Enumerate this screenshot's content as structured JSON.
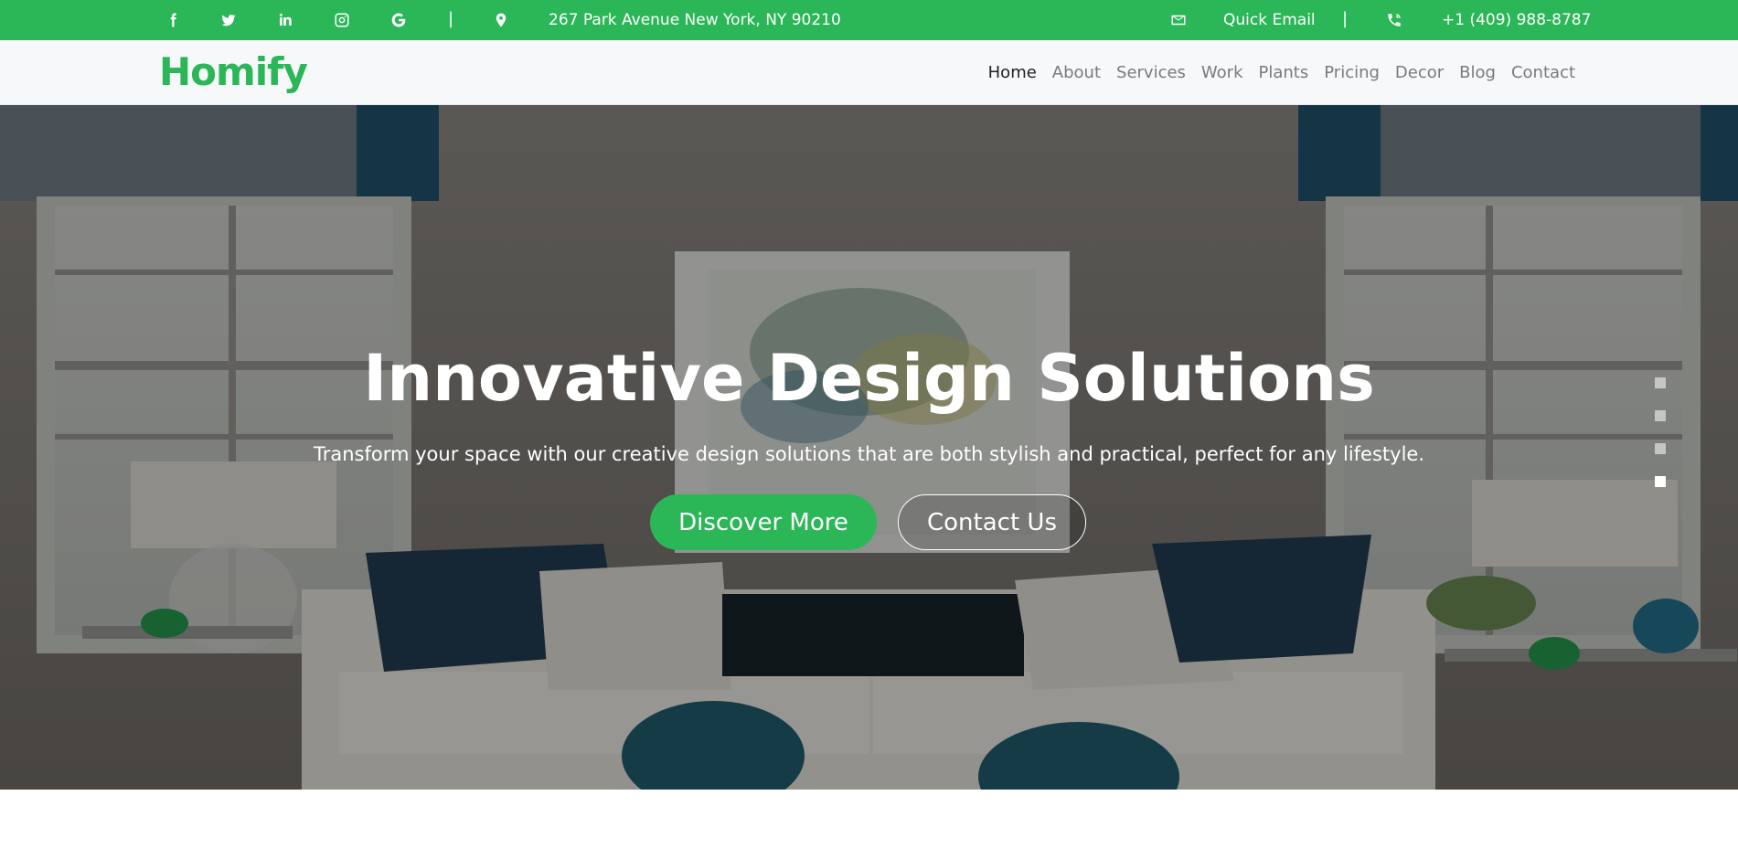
{
  "topbar": {
    "social": [
      {
        "icon": "facebook-icon"
      },
      {
        "icon": "twitter-icon"
      },
      {
        "icon": "linkedin-icon"
      },
      {
        "icon": "instagram-icon"
      },
      {
        "icon": "google-icon"
      }
    ],
    "separator": "|",
    "address": "267 Park Avenue New York, NY 90210",
    "email_label": "Quick Email",
    "phone": "+1 (409) 988-8787",
    "bg_color": "#2bb757"
  },
  "navbar": {
    "logo": "Homify",
    "links": [
      "Home",
      "About",
      "Services",
      "Work",
      "Plants",
      "Pricing",
      "Decor",
      "Blog",
      "Contact"
    ],
    "active": "Home"
  },
  "hero": {
    "title": "Innovative Design Solutions",
    "subtitle": "Transform your space with our creative design solutions that are both stylish and practical, perfect for any lifestyle.",
    "primary_button": "Discover More",
    "secondary_button": "Contact Us",
    "slides": 4,
    "active_slide": 4,
    "accent_color": "#2bb757"
  }
}
